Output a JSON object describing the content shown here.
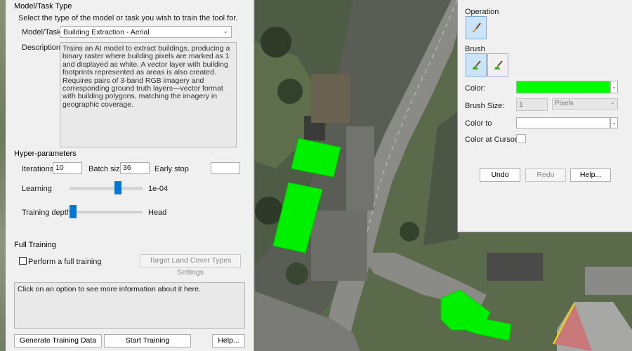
{
  "left_panel": {
    "section_model": "Model/Task Type",
    "instruction": "Select the type of the model or task you wish to train the tool for.",
    "model_label": "Model/Task",
    "model_value": "Building Extraction - Aerial",
    "description_label": "Description:",
    "description_text": "Trains an AI model to extract buildings, producing a binary raster where building pixels are marked as 1 and displayed as white. A vector layer with building footprints represented as areas is also created. Requires pairs of 3-band RGB imagery and corresponding ground truth layers—vector format with building polygons, matching the imagery in geographic coverage.",
    "section_hyper": "Hyper-parameters",
    "iterations_label": "Iterations:",
    "iterations_value": "10",
    "batch_label": "Batch size:",
    "batch_value": "36",
    "early_stop_label": "Early stop",
    "early_stop_value": "",
    "learning_label": "Learning",
    "learning_value": "1e-04",
    "learning_level": 0.68,
    "depth_label": "Training depth:",
    "depth_value": "Head",
    "depth_level": 0.0,
    "section_full": "Full Training",
    "full_training_label": "Perform a full training",
    "full_training_checked": false,
    "land_cover_button": "Target Land Cover Types Settings",
    "info_text": "Click on an option to see more information about it here.",
    "generate_button": "Generate Training Data",
    "start_button": "Start Training",
    "help_button": "Help..."
  },
  "right_panel": {
    "operation_label": "Operation",
    "brush_label": "Brush",
    "color_label": "Color:",
    "color_value": "#00ff00",
    "brush_size_label": "Brush Size:",
    "brush_size_value": "1",
    "brush_unit": "Pixels",
    "color_to_label": "Color to",
    "color_at_cursor_label": "Color at Cursor:",
    "undo_button": "Undo",
    "redo_button": "Redo",
    "help_button": "Help..."
  },
  "icons": {
    "operation": "brush-icon",
    "brush_round": "round-brush-icon",
    "brush_flat": "flat-brush-icon",
    "dropdown": "chevron-down-icon"
  },
  "colors": {
    "accent": "#0078d7",
    "annotation": "#00ff00"
  }
}
